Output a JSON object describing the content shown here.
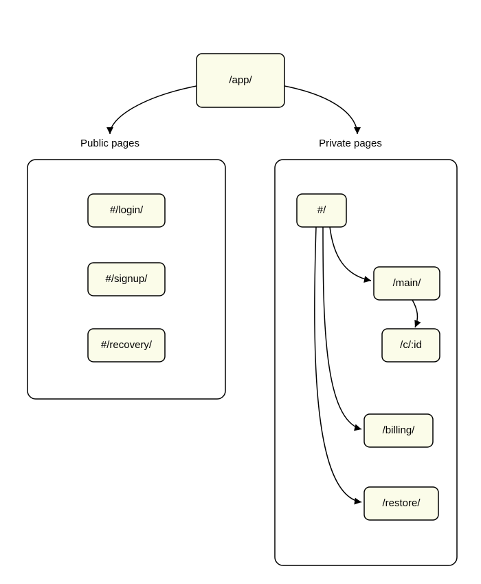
{
  "root": {
    "label": "/app/"
  },
  "groups": {
    "public": {
      "title": "Public pages"
    },
    "private": {
      "title": "Private pages"
    }
  },
  "public_nodes": {
    "login": {
      "label": "#/login/"
    },
    "signup": {
      "label": "#/signup/"
    },
    "recovery": {
      "label": "#/recovery/"
    }
  },
  "private_nodes": {
    "hash": {
      "label": "#/"
    },
    "main": {
      "label": "/main/"
    },
    "cid": {
      "label": "/c/:id"
    },
    "billing": {
      "label": "/billing/"
    },
    "restore": {
      "label": "/restore/"
    }
  },
  "edges": [
    {
      "from": "root",
      "to": "public-group"
    },
    {
      "from": "root",
      "to": "private-group"
    },
    {
      "from": "hash",
      "to": "main"
    },
    {
      "from": "main",
      "to": "cid"
    },
    {
      "from": "hash",
      "to": "billing"
    },
    {
      "from": "hash",
      "to": "restore"
    }
  ]
}
